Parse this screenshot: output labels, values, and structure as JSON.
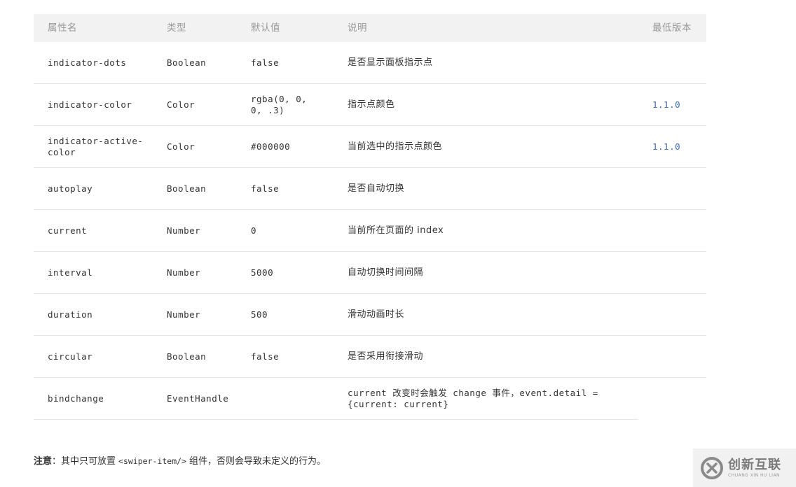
{
  "table": {
    "headers": [
      "属性名",
      "类型",
      "默认值",
      "说明",
      "最低版本"
    ],
    "rows": [
      [
        "indicator-dots",
        "Boolean",
        "false",
        "是否显示面板指示点",
        ""
      ],
      [
        "indicator-color",
        "Color",
        "rgba(0, 0, 0, .3)",
        "指示点颜色",
        "1.1.0"
      ],
      [
        "indicator-active-color",
        "Color",
        "#000000",
        "当前选中的指示点颜色",
        "1.1.0"
      ],
      [
        "autoplay",
        "Boolean",
        "false",
        "是否自动切换",
        ""
      ],
      [
        "current",
        "Number",
        "0",
        "当前所在页面的 index",
        ""
      ],
      [
        "interval",
        "Number",
        "5000",
        "自动切换时间间隔",
        ""
      ],
      [
        "duration",
        "Number",
        "500",
        "滑动动画时长",
        ""
      ],
      [
        "circular",
        "Boolean",
        "false",
        "是否采用衔接滑动",
        ""
      ],
      [
        "bindchange",
        "EventHandle",
        "",
        "current 改变时会触发 change 事件，event.detail = {current: current}",
        ""
      ]
    ]
  },
  "note": {
    "label": "注意",
    "prefix": "：其中只可放置",
    "code": "<swiper-item/>",
    "suffix": "组件，否则会导致未定义的行为。"
  },
  "watermark": {
    "main": "创新互联",
    "sub": "CHUANG XIN HU LIAN"
  },
  "colors": {
    "header_bg": "#f2f2f2",
    "header_text": "#999999",
    "version_link": "#3d6fb1",
    "divider": "#e6e6e6"
  }
}
